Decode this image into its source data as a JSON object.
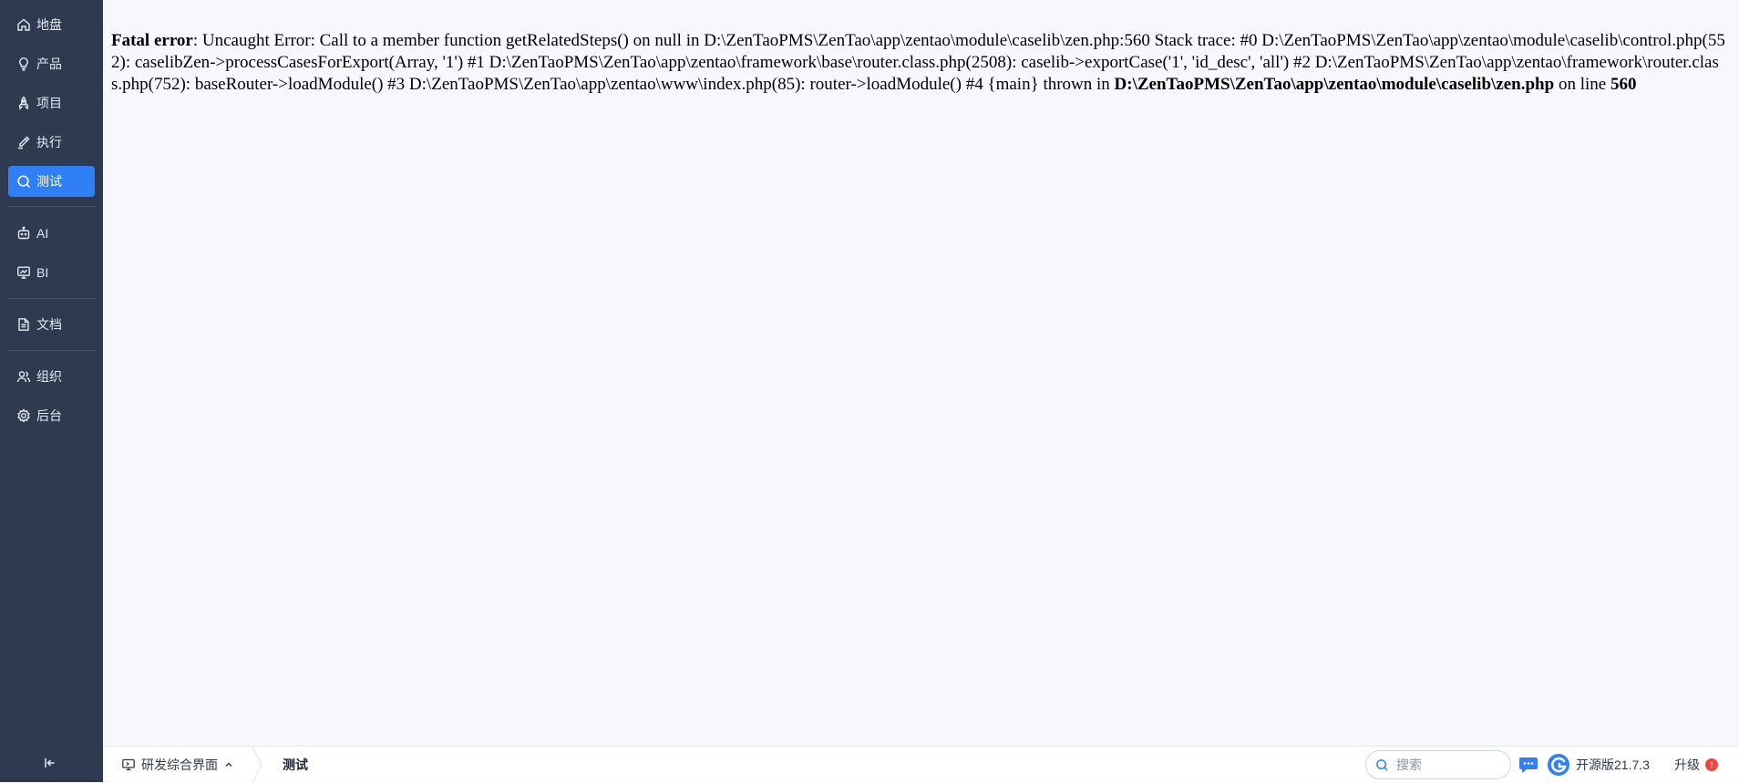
{
  "sidebar": {
    "items": [
      {
        "label": "地盘",
        "icon": "home-icon"
      },
      {
        "label": "产品",
        "icon": "lightbulb-icon"
      },
      {
        "label": "项目",
        "icon": "rocket-icon"
      },
      {
        "label": "执行",
        "icon": "pen-icon"
      },
      {
        "label": "测试",
        "icon": "search-icon",
        "active": true
      },
      {
        "label": "AI",
        "icon": "robot-icon"
      },
      {
        "label": "BI",
        "icon": "chart-board-icon"
      },
      {
        "label": "文档",
        "icon": "document-icon"
      },
      {
        "label": "组织",
        "icon": "users-icon"
      },
      {
        "label": "后台",
        "icon": "gear-icon"
      }
    ],
    "collapse_icon": "collapse-left-icon"
  },
  "error": {
    "prefix": "Fatal error",
    "message": ": Uncaught Error: Call to a member function getRelatedSteps() on null in D:\\ZenTaoPMS\\ZenTao\\app\\zentao\\module\\caselib\\zen.php:560 Stack trace: #0 D:\\ZenTaoPMS\\ZenTao\\app\\zentao\\module\\caselib\\control.php(552): caselibZen->processCasesForExport(Array, '1') #1 D:\\ZenTaoPMS\\ZenTao\\app\\zentao\\framework\\base\\router.class.php(2508): caselib->exportCase('1', 'id_desc', 'all') #2 D:\\ZenTaoPMS\\ZenTao\\app\\zentao\\framework\\router.class.php(752): baseRouter->loadModule() #3 D:\\ZenTaoPMS\\ZenTao\\app\\zentao\\www\\index.php(85): router->loadModule() #4 {main} thrown in ",
    "file": "D:\\ZenTaoPMS\\ZenTao\\app\\zentao\\module\\caselib\\zen.php",
    "line_word": " on line ",
    "line": "560"
  },
  "footer": {
    "switcher_label": "研发综合界面",
    "breadcrumb": "测试",
    "search_placeholder": "搜索",
    "version": "开源版21.7.3",
    "upgrade": "升级",
    "upgrade_badge": "↑"
  },
  "colors": {
    "sidebar_bg": "#2e3a4f",
    "active": "#2f7ff7",
    "main_bg": "#f6f8fb",
    "badge": "#f0443e"
  }
}
